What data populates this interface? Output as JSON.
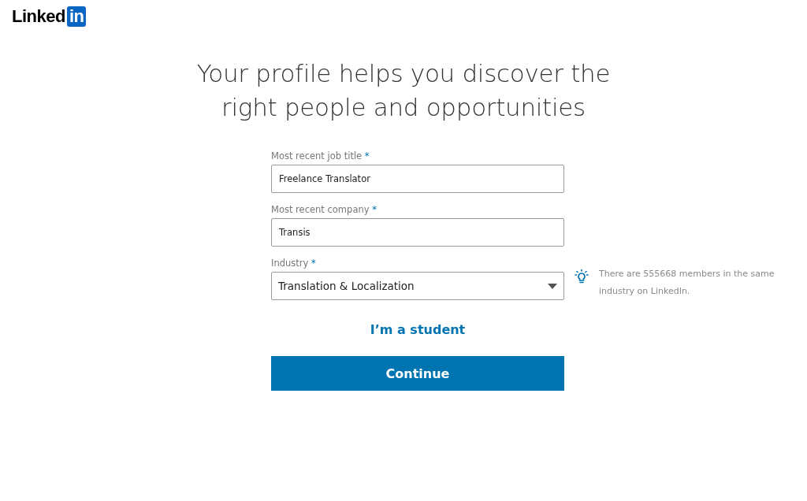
{
  "logo": {
    "word": "Linked",
    "badge": "in"
  },
  "heading": "Your profile helps you discover the right people and opportunities",
  "fields": [
    {
      "kind": "text",
      "label": "Most recent job title",
      "required_mark": "*",
      "value": "Freelance Translator"
    },
    {
      "kind": "text",
      "label": "Most recent company",
      "required_mark": "*",
      "value": "Transis"
    },
    {
      "kind": "select",
      "label": "Industry",
      "required_mark": "*",
      "value": "Translation & Localization",
      "hint": "There are 555668 members in the same industry on LinkedIn."
    }
  ],
  "student_link": "I’m a student",
  "continue_button": "Continue"
}
